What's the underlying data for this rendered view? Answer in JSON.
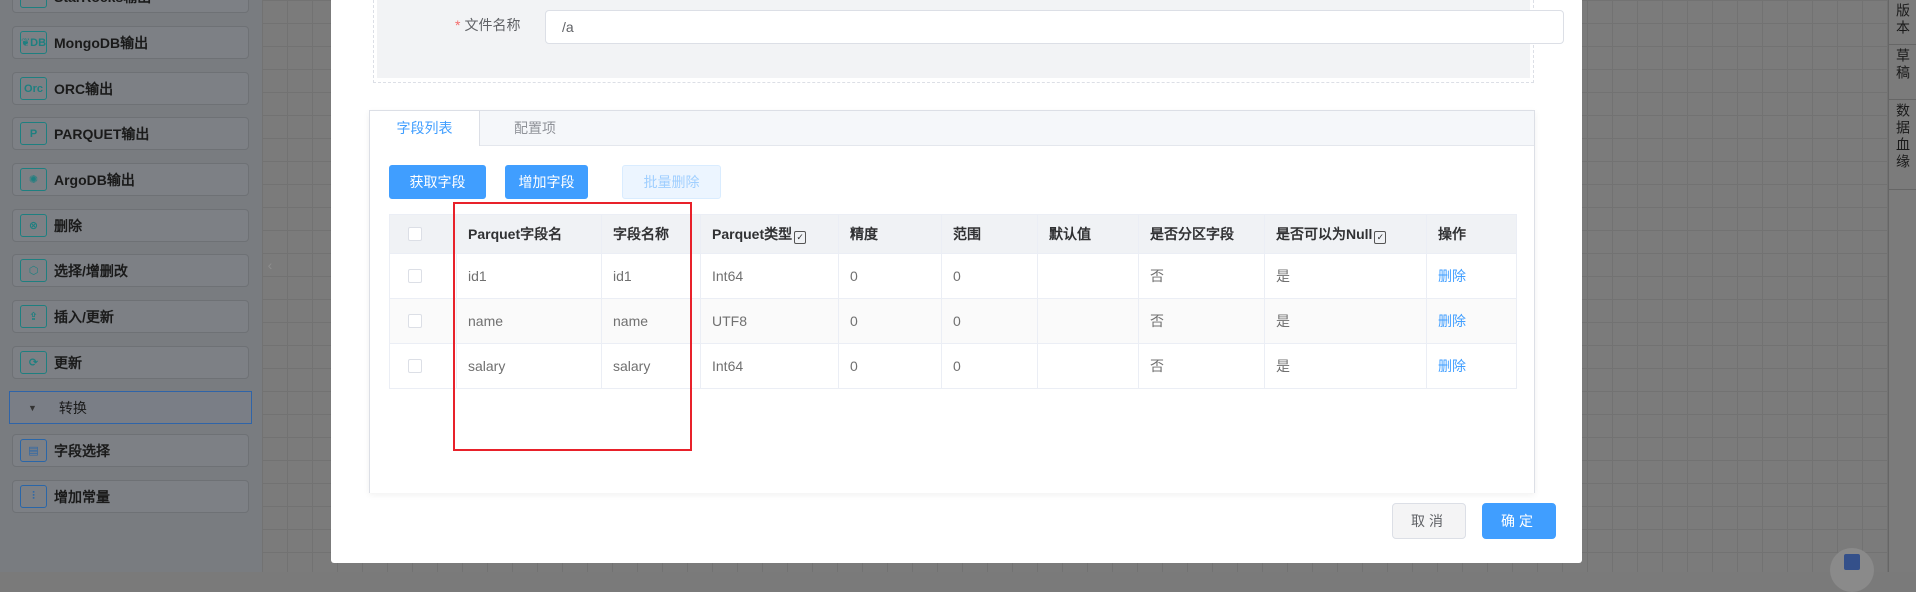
{
  "sidebar": {
    "items": [
      {
        "label": "StarRocks输出",
        "icon": "starrocks-icon",
        "glyph": "✦"
      },
      {
        "label": "MongoDB输出",
        "icon": "mongodb-icon",
        "glyph": "❦DB"
      },
      {
        "label": "ORC输出",
        "icon": "orc-icon",
        "glyph": "Orc"
      },
      {
        "label": "PARQUET输出",
        "icon": "parquet-icon",
        "glyph": "P"
      },
      {
        "label": "ArgoDB输出",
        "icon": "argodb-icon",
        "glyph": "✺"
      },
      {
        "label": "删除",
        "icon": "delete-circle-icon",
        "glyph": "⊗"
      },
      {
        "label": "选择/增删改",
        "icon": "cube-icon",
        "glyph": "⬡"
      },
      {
        "label": "插入/更新",
        "icon": "upload-icon",
        "glyph": "⇪"
      },
      {
        "label": "更新",
        "icon": "refresh-icon",
        "glyph": "⟳"
      }
    ],
    "group": {
      "label": "转换",
      "expanded": true
    },
    "group_items": [
      {
        "label": "字段选择",
        "icon": "field-select-icon",
        "glyph": "▤"
      },
      {
        "label": "增加常量",
        "icon": "add-constant-icon",
        "glyph": "⫶"
      }
    ]
  },
  "right_tabs": [
    "版本",
    "草稿",
    "数据血缘"
  ],
  "form": {
    "file_name_label": "文件名称",
    "file_name_value": "/a",
    "required_mark": "*"
  },
  "tabs": [
    {
      "label": "字段列表",
      "active": true
    },
    {
      "label": "配置项",
      "active": false
    }
  ],
  "toolbar": {
    "get_fields": "获取字段",
    "add_field": "增加字段",
    "batch_delete": "批量删除"
  },
  "table": {
    "headers": [
      "Parquet字段名",
      "字段名称",
      "Parquet类型",
      "精度",
      "范围",
      "默认值",
      "是否分区字段",
      "是否可以为Null",
      "操作"
    ],
    "rows": [
      {
        "parquet_name": "id1",
        "name": "id1",
        "type": "Int64",
        "precision": "0",
        "range": "0",
        "default": "",
        "partition": "否",
        "nullable": "是",
        "action": "删除"
      },
      {
        "parquet_name": "name",
        "name": "name",
        "type": "UTF8",
        "precision": "0",
        "range": "0",
        "default": "",
        "partition": "否",
        "nullable": "是",
        "action": "删除"
      },
      {
        "parquet_name": "salary",
        "name": "salary",
        "type": "Int64",
        "precision": "0",
        "range": "0",
        "default": "",
        "partition": "否",
        "nullable": "是",
        "action": "删除"
      }
    ]
  },
  "footer": {
    "cancel": "取消",
    "ok": "确定"
  },
  "colors": {
    "primary": "#409eff",
    "highlight": "#e8212a",
    "icon_teal": "#1e7f80"
  }
}
